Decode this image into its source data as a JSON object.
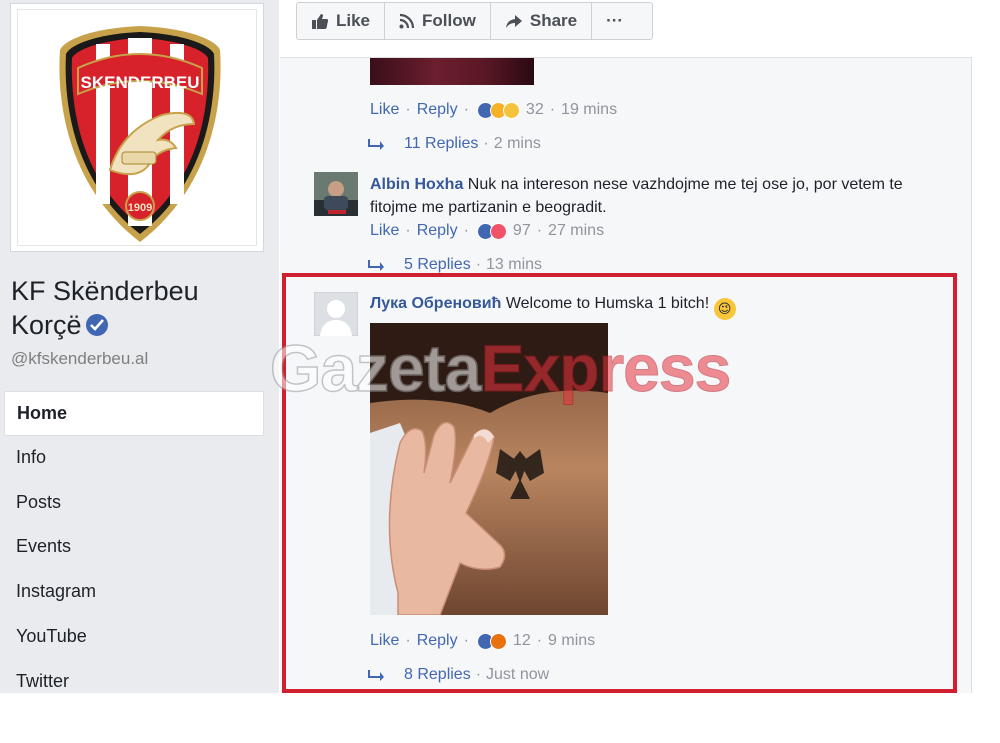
{
  "page": {
    "name": "KF Skënderbeu Korçë",
    "handle": "@kfskenderbeu.al",
    "logo_text": "SKENDERBEU",
    "logo_year": "1909",
    "nav": [
      "Home",
      "Info",
      "Posts",
      "Events",
      "Instagram",
      "YouTube",
      "Twitter"
    ]
  },
  "actions": {
    "like": "Like",
    "follow": "Follow",
    "share": "Share",
    "more": "···"
  },
  "comment_top": {
    "like": "Like",
    "reply": "Reply",
    "count": "32",
    "time": "19 mins",
    "replies": "11 Replies",
    "replies_time": "2 mins"
  },
  "comment_albin": {
    "author": "Albin Hoxha",
    "text": "Nuk na intereson nese vazhdojme me tej ose jo, por vetem te fitojme me partizanin e beogradit.",
    "like": "Like",
    "reply": "Reply",
    "count": "97",
    "time": "27 mins",
    "replies": "5 Replies",
    "replies_time": "13 mins"
  },
  "comment_luka": {
    "author": "Лука Обреновић",
    "text": "Welcome to Humska 1 bitch!",
    "emoji": "😉",
    "like": "Like",
    "reply": "Reply",
    "count": "12",
    "time": "9 mins",
    "replies": "8 Replies",
    "replies_time": "Just now"
  },
  "watermark": {
    "part1": "Gazeta",
    "part2": "Express"
  },
  "colors": {
    "accent": "#4267b2",
    "highlight": "#d01f2f",
    "sidebar_bg": "#e9ebee"
  }
}
